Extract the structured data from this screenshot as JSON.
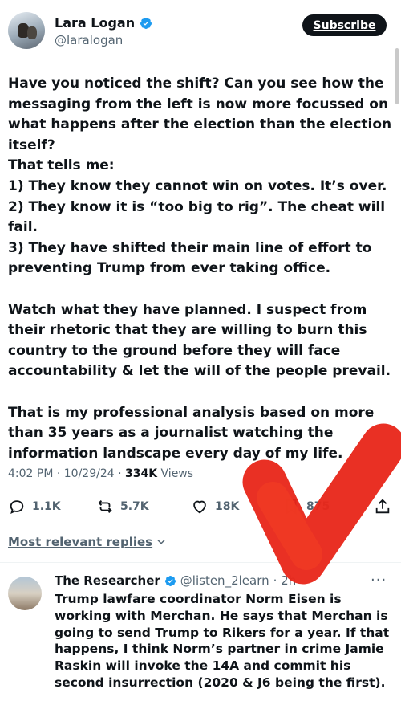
{
  "author": {
    "name": "Lara Logan",
    "handle": "@laralogan",
    "subscribe_label": "Subscribe"
  },
  "tweet": {
    "lines": [
      "Have you noticed the shift? Can you see how the messaging from the left is now more focussed on what happens after the election than the election itself?",
      "That tells me:",
      "1) They know they cannot win on votes. It’s over.",
      "2) They know it is “too big to rig”. The cheat will fail.",
      "3) They have shifted their main line of effort to preventing Trump from ever taking office.",
      "Watch what they have planned. I suspect from their rhetoric that they are willing to burn this country to the ground before they will face accountability & let the will of the people prevail.",
      "That is my professional analysis based on more than 35 years as a journalist watching the information landscape every day of my life."
    ],
    "time": "4:02 PM · 10/29/24 · ",
    "views_count": "334K",
    "views_label": " Views"
  },
  "actions": {
    "replies": "1.1K",
    "reposts": "5.7K",
    "likes": "18K",
    "bookmarks": "875"
  },
  "replies_filter": "Most relevant replies",
  "reply": {
    "name": "The Researcher",
    "handle": "@listen_2learn",
    "time": "· 2h",
    "more": "···",
    "text": "Trump lawfare coordinator Norm Eisen is working with Merchan. He says that Merchan is going to send Trump to Rikers for a year. If that happens, I think Norm’s partner in crime Jamie Raskin will invoke the 14A and commit his second insurrection (2020 & J6 being the first)."
  },
  "colors": {
    "text": "#0f1419",
    "secondary": "#536471",
    "verified": "#1d9bf0",
    "annotation": "#e8281b"
  },
  "icons": [
    "verified-badge-icon",
    "reply-icon",
    "repost-icon",
    "like-icon",
    "bookmark-icon",
    "share-icon",
    "chevron-down-icon",
    "more-icon"
  ]
}
